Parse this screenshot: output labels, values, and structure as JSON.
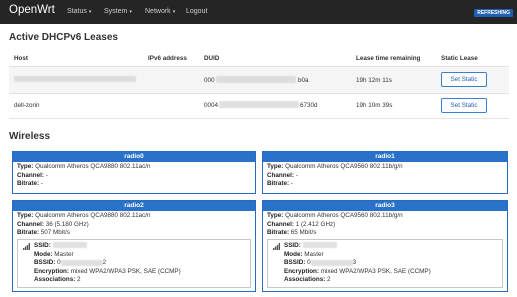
{
  "nav": {
    "brand": "OpenWrt",
    "status": "Status",
    "system": "System",
    "network": "Network",
    "logout": "Logout",
    "refreshing": "REFRESHING"
  },
  "dhcp": {
    "title": "Active DHCPv6 Leases",
    "headers": {
      "host": "Host",
      "ipv6": "IPv6 address",
      "duid": "DUID",
      "lease": "Lease time remaining",
      "static": "Static Lease"
    },
    "rows": [
      {
        "host": "",
        "duid_start": "000",
        "duid_end": "b0a",
        "lease": "19h 12m 11s",
        "button": "Set Static"
      },
      {
        "host": "dell-zorin",
        "duid_start": "0004",
        "duid_end": "6730d",
        "lease": "19h 10m 39s",
        "button": "Set Static"
      }
    ]
  },
  "wireless": {
    "title": "Wireless",
    "radios": [
      {
        "name": "radio0",
        "type_label": "Type:",
        "type": "Qualcomm Atheros QCA9880 802.11ac/n",
        "channel_label": "Channel:",
        "channel": "-",
        "bitrate_label": "Bitrate:",
        "bitrate": "-"
      },
      {
        "name": "radio1",
        "type_label": "Type:",
        "type": "Qualcomm Atheros QCA9560 802.11b/g/n",
        "channel_label": "Channel:",
        "channel": "-",
        "bitrate_label": "Bitrate:",
        "bitrate": "-"
      },
      {
        "name": "radio2",
        "type_label": "Type:",
        "type": "Qualcomm Atheros QCA9880 802.11ac/n",
        "channel_label": "Channel:",
        "channel": "36 (5.180 GHz)",
        "bitrate_label": "Bitrate:",
        "bitrate": "507 Mbit/s",
        "net": {
          "ssid_label": "SSID:",
          "mode_label": "Mode:",
          "mode": "Master",
          "bssid_label": "BSSID:",
          "bssid_start": "0",
          "bssid_end": "2",
          "enc_label": "Encryption:",
          "encryption": "mixed WPA2/WPA3 PSK, SAE (CCMP)",
          "assoc_label": "Associations:",
          "associations": "2"
        }
      },
      {
        "name": "radio3",
        "type_label": "Type:",
        "type": "Qualcomm Atheros QCA9560 802.11b/g/n",
        "channel_label": "Channel:",
        "channel": "1 (2.412 GHz)",
        "bitrate_label": "Bitrate:",
        "bitrate": "65 Mbit/s",
        "net": {
          "ssid_label": "SSID:",
          "mode_label": "Mode:",
          "mode": "Master",
          "bssid_label": "BSSID:",
          "bssid_start": "0",
          "bssid_end": "3",
          "enc_label": "Encryption:",
          "encryption": "mixed WPA2/WPA3 PSK, SAE (CCMP)",
          "assoc_label": "Associations:",
          "associations": "2"
        }
      }
    ]
  },
  "colors": {
    "navbar": "#252525",
    "accent": "#2a72c9",
    "badge": "#1f5fb0"
  }
}
